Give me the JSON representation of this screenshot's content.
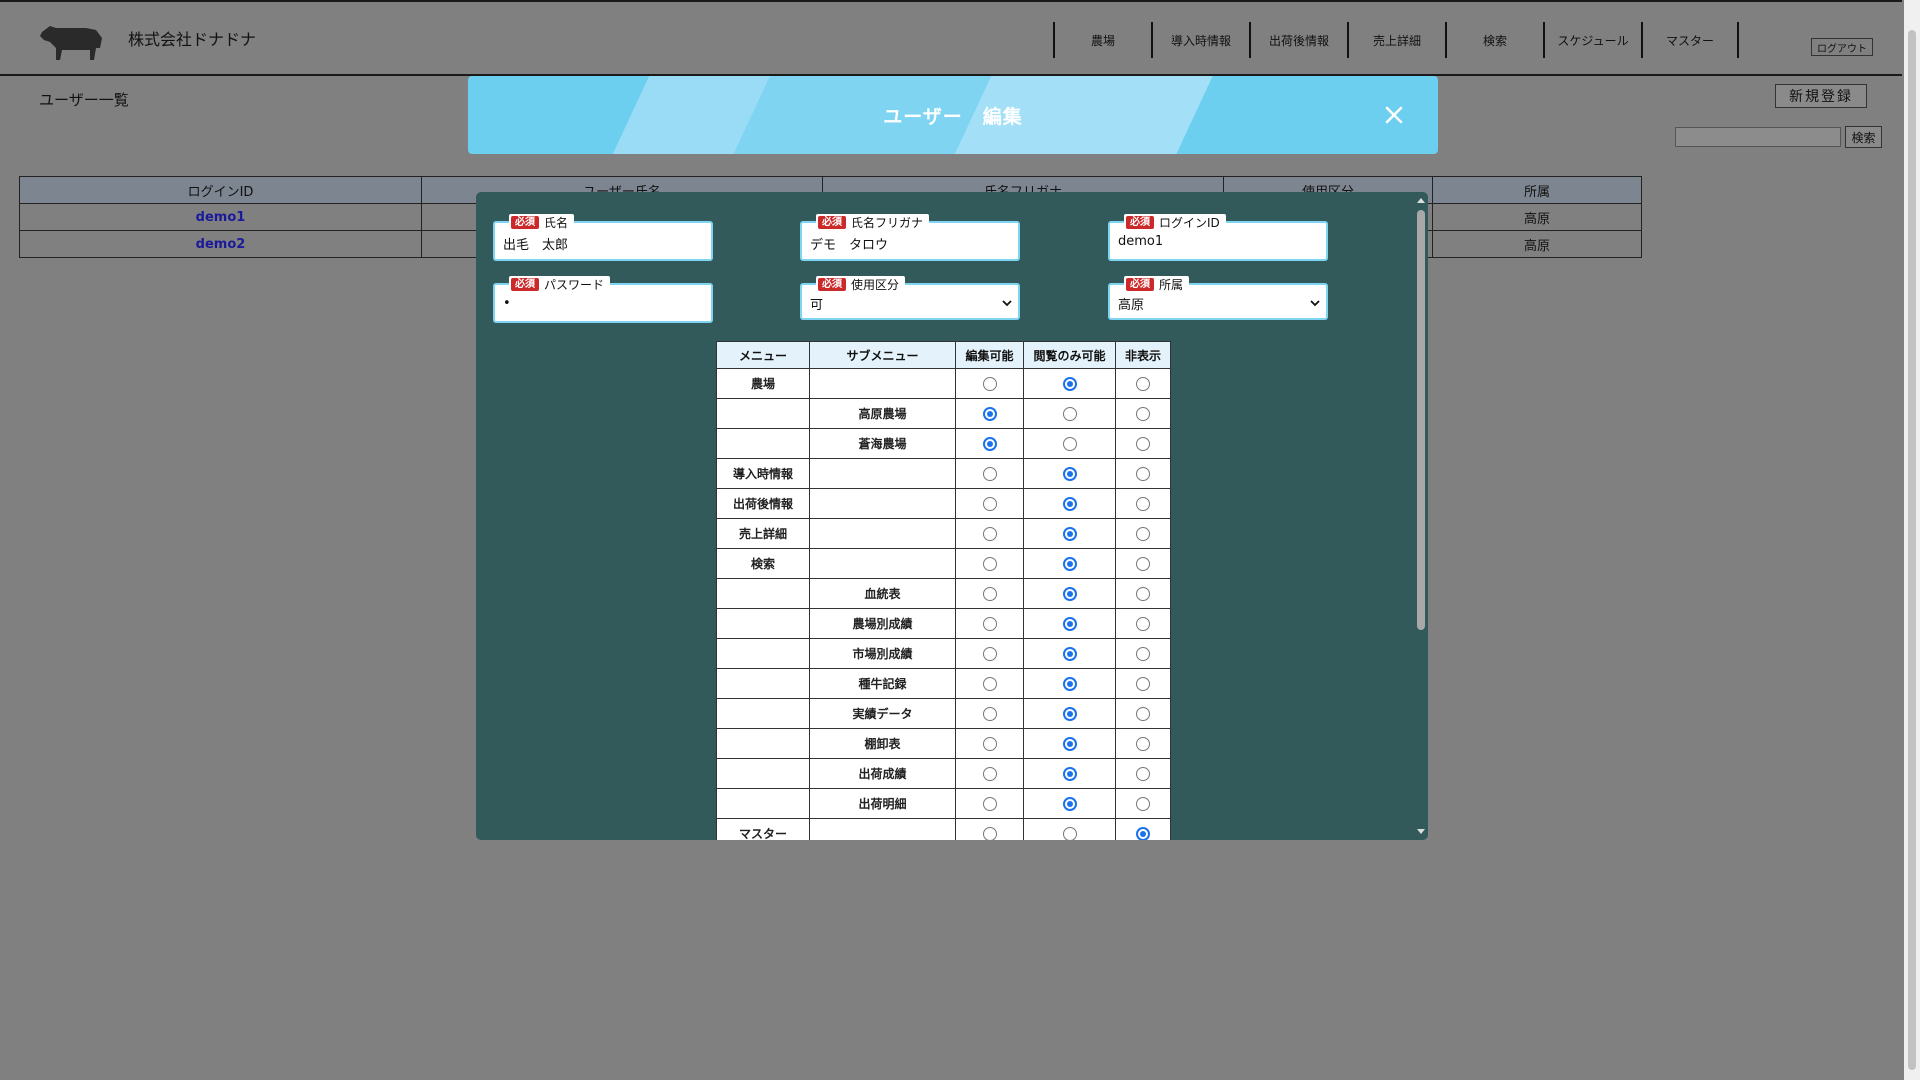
{
  "header": {
    "company": "株式会社ドナドナ",
    "nav": [
      "農場",
      "導入時情報",
      "出荷後情報",
      "売上詳細",
      "検索",
      "スケジュール",
      "マスター"
    ],
    "logout": "ログアウト"
  },
  "page": {
    "title": "ユーザー一覧",
    "new_button": "新規登録",
    "search_button": "検索"
  },
  "user_table": {
    "columns": [
      "ログインID",
      "ユーザー氏名",
      "氏名フリガナ",
      "使用区分",
      "所属"
    ],
    "rows": [
      {
        "login_id": "demo1",
        "affiliation": "高原"
      },
      {
        "login_id": "demo2",
        "affiliation": "高原"
      }
    ]
  },
  "modal": {
    "title": "ユーザー　編集",
    "required_badge": "必須",
    "fields": {
      "name": {
        "label": "氏名",
        "value": "出毛　太郎"
      },
      "furigana": {
        "label": "氏名フリガナ",
        "value": "デモ　タロウ"
      },
      "login_id": {
        "label": "ログインID",
        "value": "demo1"
      },
      "password": {
        "label": "パスワード",
        "value": "•"
      },
      "usage": {
        "label": "使用区分",
        "value": "可"
      },
      "affiliation": {
        "label": "所属",
        "value": "高原"
      }
    },
    "permissions": {
      "columns": [
        "メニュー",
        "サブメニュー",
        "編集可能",
        "閲覧のみ可能",
        "非表示"
      ],
      "rows": [
        {
          "menu": "農場",
          "sub": "",
          "selected": 1
        },
        {
          "menu": "",
          "sub": "高原農場",
          "selected": 0
        },
        {
          "menu": "",
          "sub": "蒼海農場",
          "selected": 0
        },
        {
          "menu": "導入時情報",
          "sub": "",
          "selected": 1
        },
        {
          "menu": "出荷後情報",
          "sub": "",
          "selected": 1
        },
        {
          "menu": "売上詳細",
          "sub": "",
          "selected": 1
        },
        {
          "menu": "検索",
          "sub": "",
          "selected": 1
        },
        {
          "menu": "",
          "sub": "血統表",
          "selected": 1
        },
        {
          "menu": "",
          "sub": "農場別成績",
          "selected": 1
        },
        {
          "menu": "",
          "sub": "市場別成績",
          "selected": 1
        },
        {
          "menu": "",
          "sub": "種牛記録",
          "selected": 1
        },
        {
          "menu": "",
          "sub": "実績データ",
          "selected": 1
        },
        {
          "menu": "",
          "sub": "棚卸表",
          "selected": 1
        },
        {
          "menu": "",
          "sub": "出荷成績",
          "selected": 1
        },
        {
          "menu": "",
          "sub": "出荷明細",
          "selected": 1
        },
        {
          "menu": "マスター",
          "sub": "",
          "selected": 2
        }
      ]
    }
  },
  "colors": {
    "overlay": "#808080",
    "modal_body": "#335a5a",
    "modal_header": "#6ccff0",
    "required": "#cc2a2a",
    "radio_selected": "#1a73e8"
  }
}
